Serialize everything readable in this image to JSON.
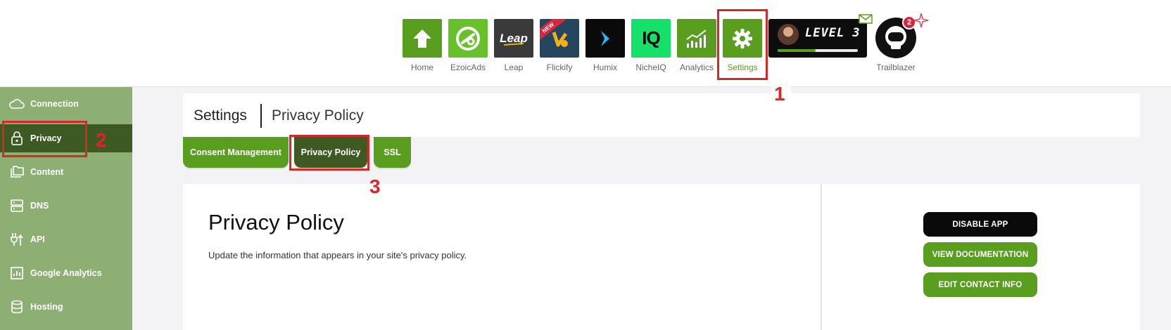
{
  "apps": [
    {
      "id": "home",
      "label": "Home",
      "color": "#5a9e1f",
      "icon": "home-icon"
    },
    {
      "id": "ezoicads",
      "label": "EzoicAds",
      "color": "#67c12a",
      "icon": "ezoicads-logo-icon"
    },
    {
      "id": "leap",
      "label": "Leap",
      "color": "#3a3a3a",
      "icon": "leap-logo-icon",
      "logo_text": "Leap"
    },
    {
      "id": "flickify",
      "label": "Flickify",
      "color": "#25465e",
      "icon": "flickify-logo-icon",
      "badge": "NEW"
    },
    {
      "id": "humix",
      "label": "Humix",
      "color": "#0a0a0a",
      "icon": "humix-chevron-icon"
    },
    {
      "id": "nicheiq",
      "label": "NicheIQ",
      "color": "#15e06a",
      "icon": "nicheiq-logo-icon",
      "logo_text": "IQ"
    },
    {
      "id": "analytics",
      "label": "Analytics",
      "color": "#5a9e1f",
      "icon": "analytics-chart-icon"
    },
    {
      "id": "settings",
      "label": "Settings",
      "color": "#5a9e1f",
      "icon": "gear-icon"
    }
  ],
  "level": {
    "text": "LEVEL 3",
    "progress": 0.47
  },
  "trailblazer": {
    "label": "Trailblazer",
    "badge": "2"
  },
  "sidebar": {
    "items": [
      {
        "label": "Connection",
        "icon": "cloud-icon"
      },
      {
        "label": "Privacy",
        "icon": "lock-icon"
      },
      {
        "label": "Content",
        "icon": "folders-icon"
      },
      {
        "label": "DNS",
        "icon": "server-icon"
      },
      {
        "label": "API",
        "icon": "api-plug-icon"
      },
      {
        "label": "Google Analytics",
        "icon": "bar-chart-icon"
      },
      {
        "label": "Hosting",
        "icon": "database-icon"
      }
    ],
    "active": "Privacy"
  },
  "header": {
    "section": "Settings",
    "page": "Privacy Policy"
  },
  "tabs": [
    {
      "label": "Consent Management"
    },
    {
      "label": "Privacy Policy"
    },
    {
      "label": "SSL"
    }
  ],
  "content": {
    "title": "Privacy Policy",
    "description": "Update the information that appears in your site's privacy policy."
  },
  "actions": {
    "disable": "DISABLE APP",
    "docs": "VIEW DOCUMENTATION",
    "contact": "EDIT CONTACT INFO"
  },
  "annotations": {
    "one": "1",
    "two": "2",
    "three": "3"
  },
  "colors": {
    "accent": "#5a9e1f",
    "accent_dark": "#3c5a22",
    "sidebar": "#8daf74",
    "annotation": "#d62828"
  }
}
